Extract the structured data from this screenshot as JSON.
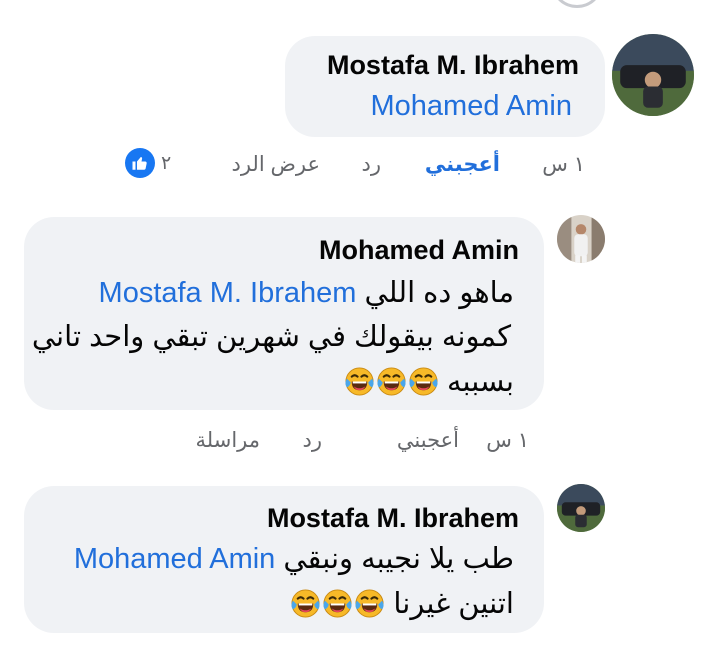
{
  "comments": [
    {
      "author": "Mostafa M. Ibrahem",
      "mention": "Mohamed Amin",
      "actions": {
        "time": "١ س",
        "like": "أعجبني",
        "reply": "رد",
        "more": "عرض الرد"
      },
      "reaction": {
        "icon": "thumbs-up-icon",
        "count": "٢"
      },
      "avatar": "avatar-mostafa"
    },
    {
      "author": "Mohamed Amin",
      "line1_text": "ماهو ده اللي ",
      "line1_mention": "Mostafa M. Ibrahem",
      "line2": "كمونه بيقولك في شهرين تبقي واحد تاني",
      "line3": "بسببه",
      "emoji": "laughing-tears-emoji",
      "actions": {
        "time": "١ س",
        "like": "أعجبني",
        "reply": "رد",
        "more": "مراسلة"
      },
      "avatar": "avatar-mohamed"
    },
    {
      "author": "Mostafa M. Ibrahem",
      "line1_text": "طب يلا نجيبه ونبقي ",
      "line1_mention": "Mohamed Amin",
      "line2": "اتنين غيرنا",
      "emoji": "laughing-tears-emoji",
      "avatar": "avatar-mostafa"
    }
  ],
  "colors": {
    "bubble": "#f0f2f5",
    "mention": "#216fdb",
    "meta": "#65676b",
    "like_badge": "#1877f2"
  }
}
